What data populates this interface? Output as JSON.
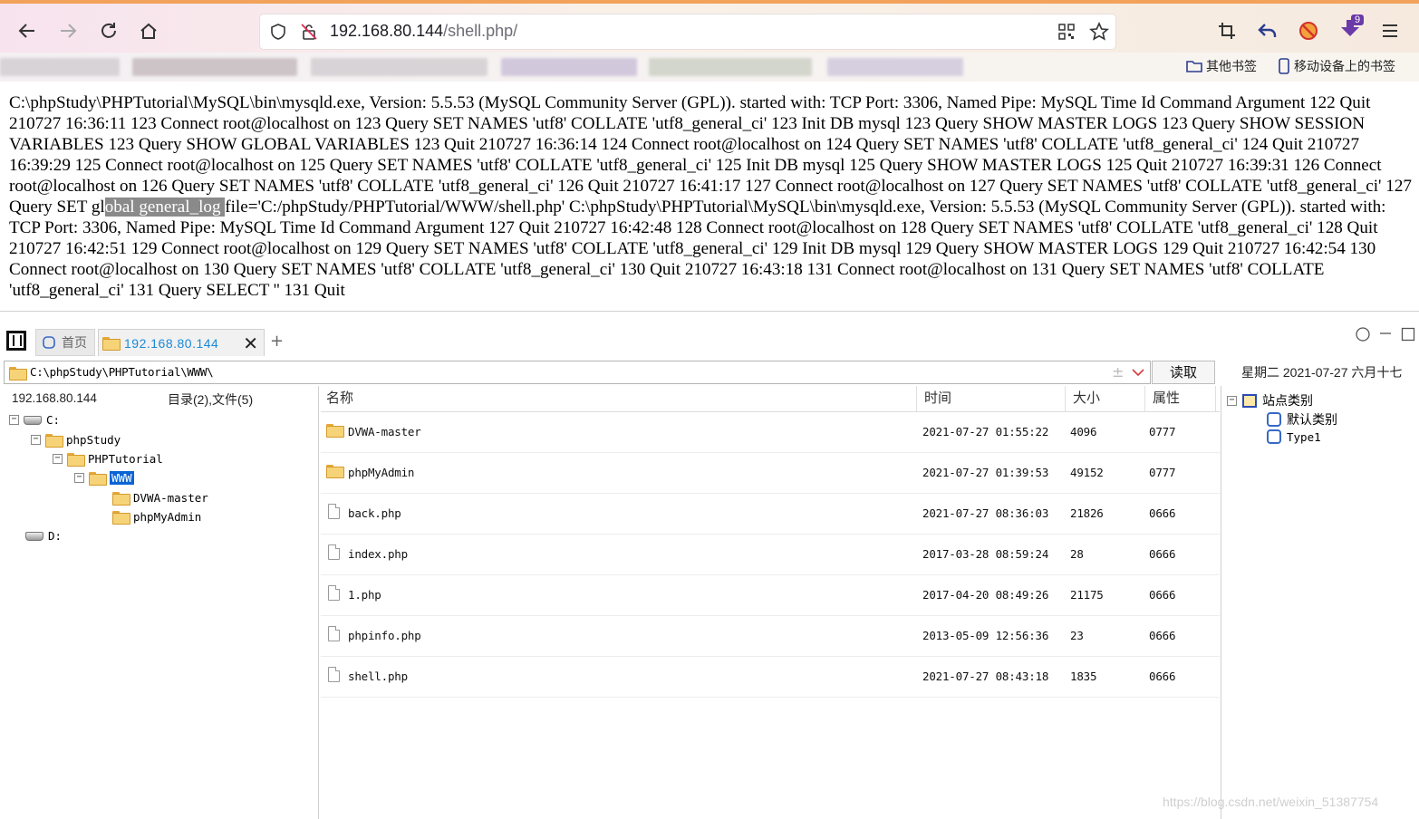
{
  "browser": {
    "url_host": "192.168.80.144",
    "url_path": "/shell.php/",
    "extension_badge": "9",
    "bookmarks_right": [
      {
        "label": "其他书签"
      },
      {
        "label": "移动设备上的书签"
      }
    ]
  },
  "page": {
    "log_before": "C:\\phpStudy\\PHPTutorial\\MySQL\\bin\\mysqld.exe, Version: 5.5.53 (MySQL Community Server (GPL)). started with: TCP Port: 3306, Named Pipe: MySQL Time Id Command Argument 122 Quit 210727 16:36:11 123 Connect root@localhost on 123 Query SET NAMES 'utf8' COLLATE 'utf8_general_ci' 123 Init DB mysql 123 Query SHOW MASTER LOGS 123 Query SHOW SESSION VARIABLES 123 Query SHOW GLOBAL VARIABLES 123 Quit 210727 16:36:14 124 Connect root@localhost on 124 Query SET NAMES 'utf8' COLLATE 'utf8_general_ci' 124 Quit 210727 16:39:29 125 Connect root@localhost on 125 Query SET NAMES 'utf8' COLLATE 'utf8_general_ci' 125 Init DB mysql 125 Query SHOW MASTER LOGS 125 Quit 210727 16:39:31 126 Connect root@localhost on 126 Query SET NAMES 'utf8' COLLATE 'utf8_general_ci' 126 Quit 210727 16:41:17 127 Connect root@localhost on 127 Query SET NAMES 'utf8' COLLATE 'utf8_general_ci' 127 Query SET gl",
    "log_highlight": "obal general_log ",
    "log_after": "file='C:/phpStudy/PHPTutorial/WWW/shell.php' C:\\phpStudy\\PHPTutorial\\MySQL\\bin\\mysqld.exe, Version: 5.5.53 (MySQL Community Server (GPL)). started with: TCP Port: 3306, Named Pipe: MySQL Time Id Command Argument 127 Quit 210727 16:42:48 128 Connect root@localhost on 128 Query SET NAMES 'utf8' COLLATE 'utf8_general_ci' 128 Quit 210727 16:42:51 129 Connect root@localhost on 129 Query SET NAMES 'utf8' COLLATE 'utf8_general_ci' 129 Init DB mysql 129 Query SHOW MASTER LOGS 129 Quit 210727 16:42:54 130 Connect root@localhost on 130 Query SET NAMES 'utf8' COLLATE 'utf8_general_ci' 130 Quit 210727 16:43:18 131 Connect root@localhost on 131 Query SET NAMES 'utf8' COLLATE 'utf8_general_ci' 131 Query SELECT '' 131 Quit"
  },
  "app": {
    "tab_home": "首页",
    "tab_active": "192.168.80.144",
    "path": "C:\\phpStudy\\PHPTutorial\\WWW\\",
    "read_button": "读取",
    "date_text": "星期二 2021-07-27 六月十七",
    "left_header_host": "192.168.80.144",
    "left_header_summary": "目录(2),文件(5)",
    "tree": [
      {
        "label": "C:",
        "expander": "−"
      },
      {
        "label": "phpStudy",
        "expander": "−"
      },
      {
        "label": "PHPTutorial",
        "expander": "−"
      },
      {
        "label": "WWW",
        "expander": "−"
      },
      {
        "label": "DVWA-master"
      },
      {
        "label": "phpMyAdmin"
      },
      {
        "label": "D:"
      }
    ],
    "columns": {
      "name": "名称",
      "time": "时间",
      "size": "大小",
      "attr": "属性"
    },
    "files": [
      {
        "name": "DVWA-master",
        "time": "2021-07-27 01:55:22",
        "size": "4096",
        "attr": "0777",
        "type": "folder"
      },
      {
        "name": "phpMyAdmin",
        "time": "2021-07-27 01:39:53",
        "size": "49152",
        "attr": "0777",
        "type": "folder"
      },
      {
        "name": "back.php",
        "time": "2021-07-27 08:36:03",
        "size": "21826",
        "attr": "0666",
        "type": "file"
      },
      {
        "name": "index.php",
        "time": "2017-03-28 08:59:24",
        "size": "28",
        "attr": "0666",
        "type": "file"
      },
      {
        "name": "1.php",
        "time": "2017-04-20 08:49:26",
        "size": "21175",
        "attr": "0666",
        "type": "file"
      },
      {
        "name": "phpinfo.php",
        "time": "2013-05-09 12:56:36",
        "size": "23",
        "attr": "0666",
        "type": "file"
      },
      {
        "name": "shell.php",
        "time": "2021-07-27 08:43:18",
        "size": "1835",
        "attr": "0666",
        "type": "file"
      }
    ],
    "categories": {
      "root": "站点类别",
      "items": [
        "默认类别",
        "Type1"
      ]
    }
  },
  "watermark": "https://blog.csdn.net/weixin_51387754"
}
